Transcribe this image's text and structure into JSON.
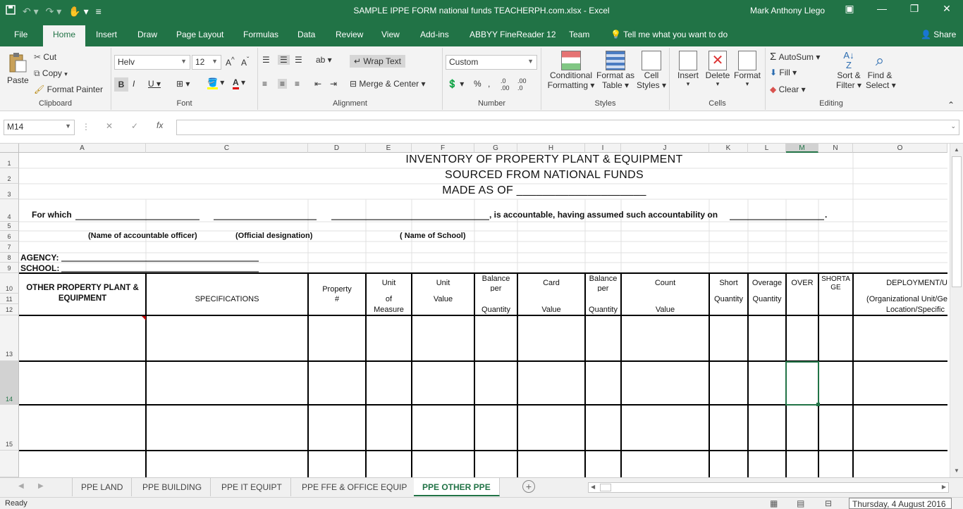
{
  "window": {
    "title": "SAMPLE IPPE FORM national funds  TEACHERPH.com.xlsx - Excel",
    "user": "Mark Anthony Llego"
  },
  "tabs": [
    "File",
    "Home",
    "Insert",
    "Draw",
    "Page Layout",
    "Formulas",
    "Data",
    "Review",
    "View",
    "Add-ins",
    "ABBYY FineReader 12",
    "Team"
  ],
  "tell_me": "Tell me what you want to do",
  "share": "Share",
  "ribbon": {
    "clipboard": {
      "label": "Clipboard",
      "paste": "Paste",
      "cut": "Cut",
      "copy": "Copy",
      "format_painter": "Format Painter"
    },
    "font": {
      "label": "Font",
      "name": "Helv",
      "size": "12"
    },
    "alignment": {
      "label": "Alignment",
      "wrap": "Wrap Text",
      "merge": "Merge & Center"
    },
    "number": {
      "label": "Number",
      "format": "Custom"
    },
    "styles": {
      "label": "Styles",
      "cond1": "Conditional",
      "cond2": "Formatting",
      "fmt1": "Format as",
      "fmt2": "Table",
      "cell1": "Cell",
      "cell2": "Styles"
    },
    "cells": {
      "label": "Cells",
      "insert": "Insert",
      "delete": "Delete",
      "format": "Format"
    },
    "editing": {
      "label": "Editing",
      "autosum": "AutoSum",
      "fill": "Fill",
      "clear": "Clear",
      "sort1": "Sort &",
      "sort2": "Filter",
      "find1": "Find &",
      "find2": "Select"
    }
  },
  "formula_bar": {
    "name_box": "M14",
    "value": ""
  },
  "columns": [
    "A",
    "C",
    "D",
    "E",
    "F",
    "G",
    "H",
    "I",
    "J",
    "K",
    "L",
    "M",
    "N",
    "O"
  ],
  "rows": [
    "1",
    "2",
    "3",
    "4",
    "5",
    "6",
    "7",
    "8",
    "9",
    "10",
    "11",
    "12",
    "13",
    "14",
    "15"
  ],
  "sheet": {
    "title1": "INVENTORY OF PROPERTY PLANT & EQUIPMENT",
    "title2": "SOURCED FROM NATIONAL FUNDS",
    "title3": "MADE AS OF ____________________",
    "for_which": "For which",
    "accountable": ", is accountable, having assumed such accountability on",
    "name_officer": "(Name of accountable officer)",
    "official_designation": "(Official designation)",
    "name_school": "( Name of School)",
    "agency": "AGENCY:",
    "school": "SCHOOL:",
    "h_other1": "OTHER PROPERTY PLANT &",
    "h_other2": "EQUIPMENT",
    "h_spec": "SPECIFICATIONS",
    "h_prop1": "Property",
    "h_prop2": "#",
    "h_unit1": "Unit",
    "h_unit2": "of",
    "h_unit3": "Measure",
    "h_uval1": "Unit",
    "h_uval2": "Value",
    "h_bal1": "Balance",
    "h_bal2": "per",
    "h_qty": "Quantity",
    "h_card": "Card",
    "h_value": "Value",
    "h_bal3": "Balance",
    "h_bal4": "per",
    "h_qty2": "Quantity",
    "h_count": "Count",
    "h_value2": "Value",
    "h_short": "Short",
    "h_qty3": "Quantity",
    "h_over": "Overage",
    "h_qty4": "Quantity",
    "h_over2": "OVER",
    "h_shorta": "SHORTA",
    "h_ge": "GE",
    "h_deploy": "DEPLOYMENT/U",
    "h_org": "(Organizational Unit/Ge",
    "h_loc": "Location/Specific"
  },
  "sheet_tabs": [
    "PPE LAND",
    "PPE BUILDING",
    "PPE IT EQUIPT",
    "PPE FFE & OFFICE EQUIP",
    "PPE OTHER PPE"
  ],
  "active_sheet": "PPE OTHER PPE",
  "status": {
    "ready": "Ready",
    "date": "Thursday, 4 August 2016"
  },
  "colors": {
    "brand": "#217346",
    "ribbon": "#f3f3f3"
  }
}
